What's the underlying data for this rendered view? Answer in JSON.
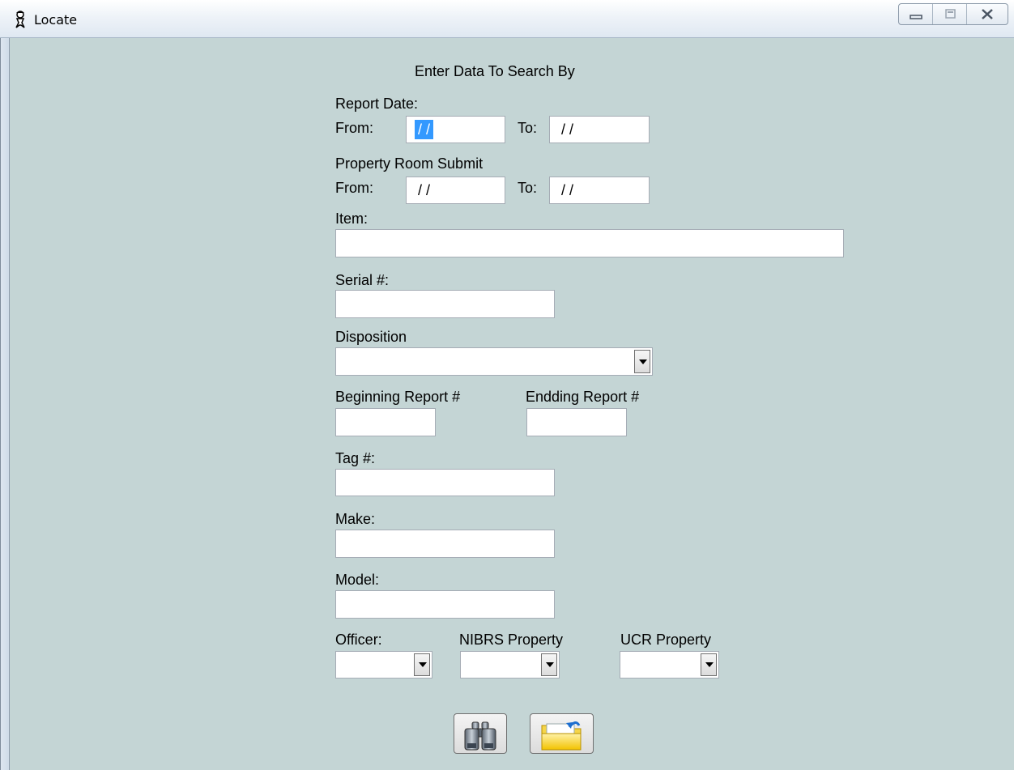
{
  "window": {
    "title": "Locate"
  },
  "form": {
    "heading": "Enter Data To Search By",
    "report_date": {
      "label": "Report Date:",
      "from_label": "From:",
      "from_value": " / /",
      "to_label": "To:",
      "to_value": " / /"
    },
    "property_room": {
      "label": "Property Room Submit",
      "from_label": "From:",
      "from_value": " / /",
      "to_label": "To:",
      "to_value": " / /"
    },
    "item": {
      "label": "Item:",
      "value": ""
    },
    "serial": {
      "label": "Serial #:",
      "value": ""
    },
    "disposition": {
      "label": "Disposition",
      "value": ""
    },
    "beginning_report": {
      "label": "Beginning Report #",
      "value": ""
    },
    "ending_report": {
      "label": "Endding Report #",
      "value": ""
    },
    "tag": {
      "label": "Tag #:",
      "value": ""
    },
    "make": {
      "label": "Make:",
      "value": ""
    },
    "model": {
      "label": "Model:",
      "value": ""
    },
    "officer": {
      "label": "Officer:",
      "value": ""
    },
    "nibrs": {
      "label": "NIBRS Property",
      "value": ""
    },
    "ucr": {
      "label": "UCR Property",
      "value": ""
    }
  },
  "buttons": {
    "search_icon": "binoculars-icon",
    "open_icon": "open-folder-icon"
  },
  "colors": {
    "background": "#c4d5d5",
    "selection": "#3399ff"
  }
}
